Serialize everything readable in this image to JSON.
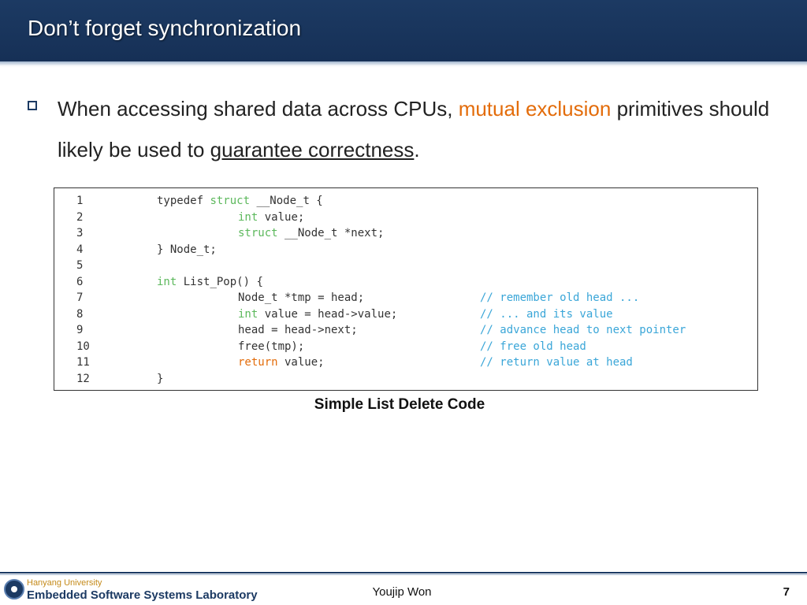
{
  "slide": {
    "title": "Don’t forget synchronization",
    "bullet": {
      "part1": "When accessing shared data across CPUs, ",
      "highlight": "mutual exclusion",
      "part2": " primitives should likely be used to ",
      "underlined": "guarantee correctness",
      "part3": "."
    },
    "code": [
      {
        "num": "1",
        "a": "typedef ",
        "a_kw": "struct",
        "a_rest": " __Node_t {",
        "b_kw": "",
        "b": "",
        "comment": ""
      },
      {
        "num": "2",
        "a": "",
        "a_kw": "",
        "a_rest": "",
        "b_kw": "int",
        "b": " value;",
        "comment": ""
      },
      {
        "num": "3",
        "a": "",
        "a_kw": "",
        "a_rest": "",
        "b_kw": "struct",
        "b": " __Node_t *next;",
        "comment": ""
      },
      {
        "num": "4",
        "a": "} Node_t;",
        "a_kw": "",
        "a_rest": "",
        "b_kw": "",
        "b": "",
        "comment": ""
      },
      {
        "num": "5",
        "a": "",
        "a_kw": "",
        "a_rest": "",
        "b_kw": "",
        "b": "",
        "comment": ""
      },
      {
        "num": "6",
        "a": "",
        "a_kw": "int",
        "a_rest": " List_Pop() {",
        "b_kw": "",
        "b": "",
        "comment": ""
      },
      {
        "num": "7",
        "a": "",
        "a_kw": "",
        "a_rest": "",
        "b_kw": "",
        "b": "Node_t *tmp = head;",
        "comment": "// remember old head ..."
      },
      {
        "num": "8",
        "a": "",
        "a_kw": "",
        "a_rest": "",
        "b_kw": "int",
        "b": " value = head->value;",
        "comment": "// ... and its value"
      },
      {
        "num": "9",
        "a": "",
        "a_kw": "",
        "a_rest": "",
        "b_kw": "",
        "b": "head = head->next;",
        "comment": "// advance head to next pointer"
      },
      {
        "num": "10",
        "a": "",
        "a_kw": "",
        "a_rest": "",
        "b_kw": "",
        "b": "free(tmp);",
        "comment": "// free old head"
      },
      {
        "num": "11",
        "a": "",
        "a_kw": "",
        "a_rest": "",
        "b_kw": "return",
        "b": " value;",
        "comment": "// return value at head"
      },
      {
        "num": "12",
        "a": "}",
        "a_kw": "",
        "a_rest": "",
        "b_kw": "",
        "b": "",
        "comment": ""
      }
    ],
    "caption": "Simple List Delete Code"
  },
  "footer": {
    "university": "Hanyang University",
    "lab": "Embedded Software Systems Laboratory",
    "author": "Youjip Won",
    "page_number": "7"
  },
  "colors": {
    "title_bar": "#1c3a63",
    "highlight": "#e36c0a",
    "code_keyword": "#5cb85c",
    "code_comment": "#3aa6d8"
  }
}
